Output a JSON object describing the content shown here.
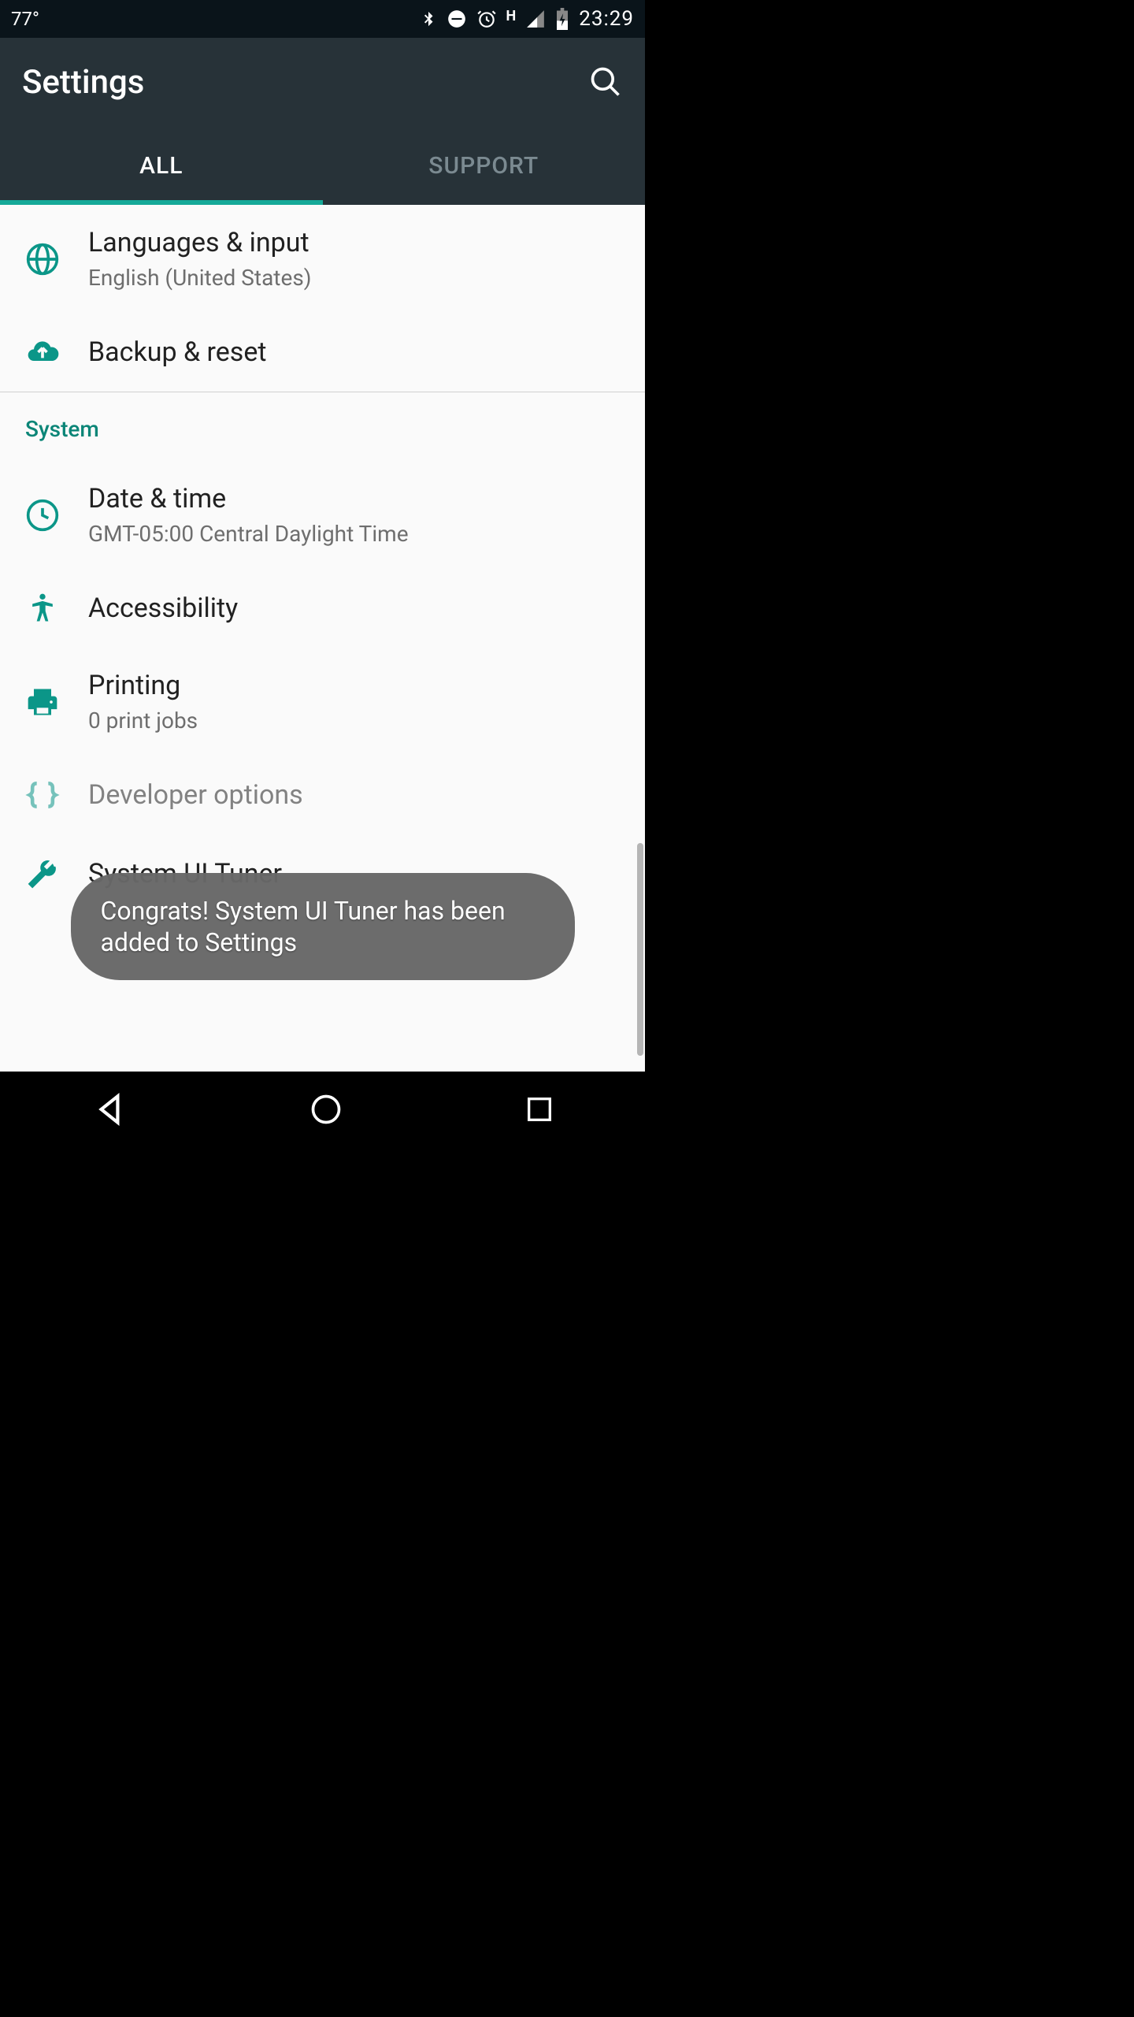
{
  "status": {
    "temp": "77°",
    "clock": "23:29",
    "network_label": "H"
  },
  "header": {
    "title": "Settings"
  },
  "tabs": {
    "all": "ALL",
    "support": "SUPPORT"
  },
  "items": {
    "languages": {
      "title": "Languages & input",
      "subtitle": "English (United States)"
    },
    "backup": {
      "title": "Backup & reset"
    },
    "datetime": {
      "title": "Date & time",
      "subtitle": "GMT-05:00 Central Daylight Time"
    },
    "accessibility": {
      "title": "Accessibility"
    },
    "printing": {
      "title": "Printing",
      "subtitle": "0 print jobs"
    },
    "developer": {
      "title": "Developer options"
    },
    "uituner": {
      "title": "System UI Tuner"
    }
  },
  "section": {
    "system": "System"
  },
  "toast": {
    "text": "Congrats! System UI Tuner has been added to Settings"
  },
  "colors": {
    "accent": "#0b9688",
    "header": "#273238"
  }
}
